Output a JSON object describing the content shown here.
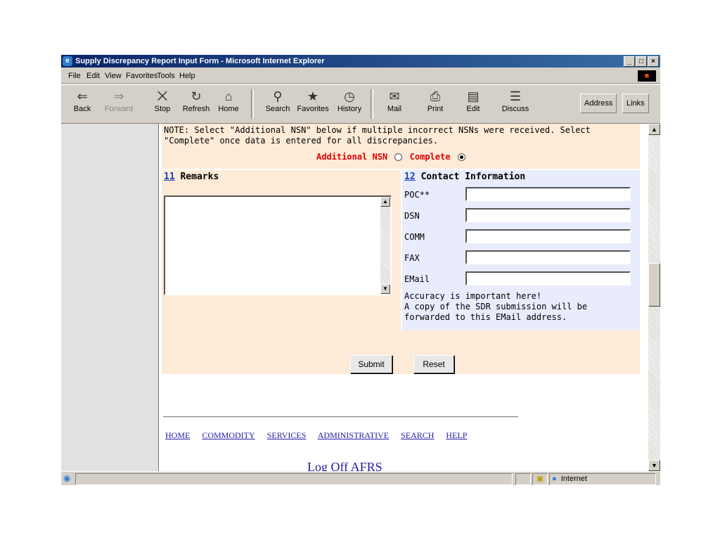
{
  "window": {
    "title": "Supply Discrepancy Report Input Form - Microsoft Internet Explorer",
    "controls": [
      "_",
      "□",
      "×"
    ]
  },
  "menu": [
    "File",
    "Edit",
    "View",
    "Favorites",
    "Tools",
    "Help"
  ],
  "toolbar": {
    "buttons": [
      "Back",
      "Forward",
      "Stop",
      "Refresh",
      "Home",
      "Search",
      "Favorites",
      "History",
      "Mail",
      "Print",
      "Edit",
      "Discuss"
    ],
    "address_label": "Address",
    "links_label": "Links"
  },
  "note": {
    "text": "NOTE: Select \"Additional NSN\" below if multiple incorrect NSNs were received. Select \"Complete\" once data is entered for all discrepancies.",
    "option_additional": "Additional NSN",
    "option_complete": "Complete",
    "selected": "Complete"
  },
  "remarks": {
    "number": "11",
    "label": "Remarks",
    "value": ""
  },
  "contact": {
    "number": "12",
    "label": "Contact Information",
    "fields": [
      {
        "label": "POC**",
        "value": ""
      },
      {
        "label": "DSN",
        "value": ""
      },
      {
        "label": "COMM",
        "value": ""
      },
      {
        "label": "FAX",
        "value": ""
      },
      {
        "label": "EMail",
        "value": ""
      }
    ],
    "note_line1": "Accuracy is important here!",
    "note_line2": "A copy of the SDR submission will be",
    "note_line3": "forwarded to this EMail address."
  },
  "actions": {
    "submit": "Submit",
    "reset": "Reset"
  },
  "footer_links": [
    "HOME",
    "COMMODITY",
    "SERVICES",
    "ADMINISTRATIVE",
    "SEARCH",
    "HELP"
  ],
  "footer_title": "Log Off AFRS",
  "status": {
    "zone": "Internet"
  }
}
